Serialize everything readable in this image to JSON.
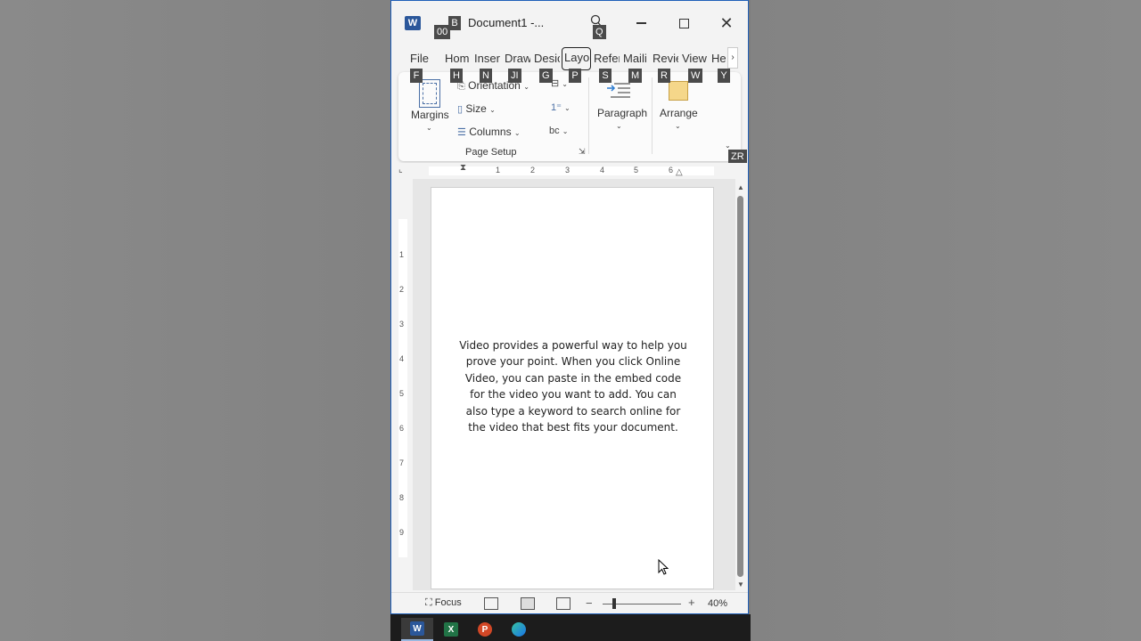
{
  "window": {
    "title": "Document1  -...",
    "app_icon": "W"
  },
  "keytips": {
    "qat_1": "00",
    "qat_2": "B",
    "search": "Q",
    "file": "F",
    "home": "H",
    "insert": "N",
    "draw": "JI",
    "design": "G",
    "layout": "P",
    "references": "S",
    "mailings": "M",
    "review": "R",
    "view": "W",
    "help": "Y",
    "collapse": "ZR"
  },
  "tabs": [
    {
      "label": "File"
    },
    {
      "label": "Hom"
    },
    {
      "label": "Inser"
    },
    {
      "label": "Draw"
    },
    {
      "label": "Desic"
    },
    {
      "label": "Layo"
    },
    {
      "label": "Refer"
    },
    {
      "label": "Maili"
    },
    {
      "label": "Revie"
    },
    {
      "label": "View"
    },
    {
      "label": "He"
    }
  ],
  "ribbon": {
    "margins": "Margins",
    "orientation": "Orientation",
    "size": "Size",
    "columns": "Columns",
    "group_label": "Page Setup",
    "paragraph": "Paragraph",
    "arrange": "Arrange",
    "hyphen_icon": "bc"
  },
  "ruler": {
    "h_numbers": [
      "1",
      "2",
      "3",
      "4",
      "5",
      "6"
    ],
    "v_numbers": [
      "1",
      "2",
      "3",
      "4",
      "5",
      "6",
      "7",
      "8",
      "9"
    ]
  },
  "document": {
    "body": "Video provides a powerful way to help you prove your point. When you click Online Video, you can paste in the embed code for the video you want to add. You can also type a keyword to search online for the video that best fits your document."
  },
  "statusbar": {
    "focus": "Focus",
    "zoom": "40%",
    "zoom_minus": "−",
    "zoom_plus": "+"
  },
  "taskbar": {
    "apps": [
      "word-icon",
      "excel-icon",
      "powerpoint-icon",
      "edge-icon"
    ],
    "labels": {
      "word": "W",
      "excel": "X",
      "powerpoint": "P"
    }
  },
  "colors": {
    "word_blue": "#2b579a",
    "excel_green": "#217346",
    "powerpoint_red": "#d24726",
    "taskbar": "#1c1c1c"
  }
}
